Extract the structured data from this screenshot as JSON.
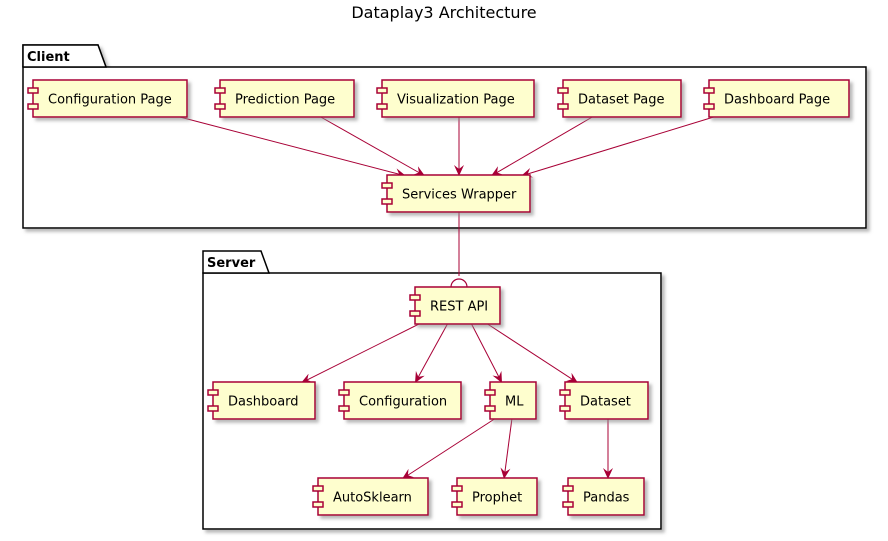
{
  "title": "Dataplay3 Architecture",
  "colors": {
    "component_fill": "#FEFECE",
    "component_border": "#A80036",
    "arrow": "#A80036",
    "package_border": "#000000",
    "shadow": "#888888"
  },
  "packages": [
    {
      "id": "client",
      "label": "Client"
    },
    {
      "id": "server",
      "label": "Server"
    }
  ],
  "components": [
    {
      "id": "configuration_page",
      "label": "Configuration Page",
      "package": "client"
    },
    {
      "id": "prediction_page",
      "label": "Prediction Page",
      "package": "client"
    },
    {
      "id": "visualization_page",
      "label": "Visualization Page",
      "package": "client"
    },
    {
      "id": "dataset_page",
      "label": "Dataset Page",
      "package": "client"
    },
    {
      "id": "dashboard_page",
      "label": "Dashboard Page",
      "package": "client"
    },
    {
      "id": "services_wrapper",
      "label": "Services Wrapper",
      "package": "client"
    },
    {
      "id": "rest_api",
      "label": "REST API",
      "package": "server"
    },
    {
      "id": "dashboard",
      "label": "Dashboard",
      "package": "server"
    },
    {
      "id": "configuration",
      "label": "Configuration",
      "package": "server"
    },
    {
      "id": "ml",
      "label": "ML",
      "package": "server"
    },
    {
      "id": "dataset",
      "label": "Dataset",
      "package": "server"
    },
    {
      "id": "autosklearn",
      "label": "AutoSklearn",
      "package": "server"
    },
    {
      "id": "prophet",
      "label": "Prophet",
      "package": "server"
    },
    {
      "id": "pandas",
      "label": "Pandas",
      "package": "server"
    }
  ],
  "edges": [
    {
      "from": "configuration_page",
      "to": "services_wrapper",
      "type": "arrow"
    },
    {
      "from": "prediction_page",
      "to": "services_wrapper",
      "type": "arrow"
    },
    {
      "from": "visualization_page",
      "to": "services_wrapper",
      "type": "arrow"
    },
    {
      "from": "dataset_page",
      "to": "services_wrapper",
      "type": "arrow"
    },
    {
      "from": "dashboard_page",
      "to": "services_wrapper",
      "type": "arrow"
    },
    {
      "from": "services_wrapper",
      "to": "rest_api",
      "type": "socket"
    },
    {
      "from": "rest_api",
      "to": "dashboard",
      "type": "arrow"
    },
    {
      "from": "rest_api",
      "to": "configuration",
      "type": "arrow"
    },
    {
      "from": "rest_api",
      "to": "ml",
      "type": "arrow"
    },
    {
      "from": "rest_api",
      "to": "dataset",
      "type": "arrow"
    },
    {
      "from": "ml",
      "to": "autosklearn",
      "type": "arrow"
    },
    {
      "from": "ml",
      "to": "prophet",
      "type": "arrow"
    },
    {
      "from": "dataset",
      "to": "pandas",
      "type": "arrow"
    }
  ]
}
